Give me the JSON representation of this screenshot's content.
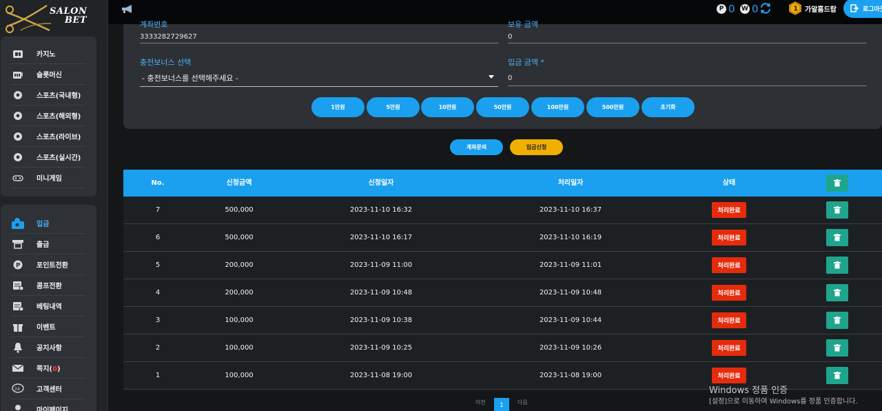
{
  "brand": {
    "line1": "SALON",
    "line2": "BET"
  },
  "sidebar": {
    "top_menu": [
      {
        "label": "카지노",
        "icon": "casino-icon"
      },
      {
        "label": "슬롯머신",
        "icon": "slot-icon"
      },
      {
        "label": "스포츠(국내형)",
        "icon": "soccer-ball-icon"
      },
      {
        "label": "스포츠(해외형)",
        "icon": "soccer-ball-icon"
      },
      {
        "label": "스포츠(라이브)",
        "icon": "soccer-ball-icon"
      },
      {
        "label": "스포츠(실시간)",
        "icon": "soccer-ball-icon"
      },
      {
        "label": "미니게임",
        "icon": "gamepad-icon"
      }
    ],
    "account_menu": [
      {
        "label": "입금",
        "icon": "deposit-icon",
        "active": true
      },
      {
        "label": "출금",
        "icon": "withdraw-icon"
      },
      {
        "label": "포인트전환",
        "icon": "point-icon"
      },
      {
        "label": "콤프전환",
        "icon": "comp-icon"
      },
      {
        "label": "베팅내역",
        "icon": "history-icon"
      },
      {
        "label": "이벤트",
        "icon": "gift-icon"
      },
      {
        "label": "공지사항",
        "icon": "bell-icon"
      },
      {
        "label": "쪽지",
        "icon": "mail-icon",
        "badge": "0"
      },
      {
        "label": "고객센터",
        "icon": "support-icon"
      },
      {
        "label": "마이페이지",
        "icon": "user-icon"
      }
    ]
  },
  "topbar": {
    "points_letter": "P",
    "points_value": "0",
    "wallet_letter": "W",
    "wallet_value": "0",
    "rank": "1",
    "username": "가알흠드랍",
    "logout_label": "로그아웃"
  },
  "form": {
    "account_label": "계좌번호",
    "account_value": "3333282729627",
    "balance_label": "보유 금액",
    "balance_value": "0",
    "bonus_label": "충전보너스 선택",
    "bonus_selected": "- 충전보너스를 선택해주세요 -",
    "amount_label": "입금 금액 *",
    "amount_value": "0",
    "amount_buttons": [
      "1만원",
      "5만원",
      "10만원",
      "50만원",
      "100만원",
      "500만원",
      "초기화"
    ]
  },
  "actions": {
    "inquiry": "계좌문의",
    "submit": "입금신청"
  },
  "table": {
    "headers": {
      "no": "No.",
      "amount": "신청금액",
      "request_date": "신청일자",
      "process_date": "처리일자",
      "status": "상태"
    },
    "rows": [
      {
        "no": "7",
        "amount": "500,000",
        "request_date": "2023-11-10 16:32",
        "process_date": "2023-11-10 16:37",
        "status": "처리완료"
      },
      {
        "no": "6",
        "amount": "500,000",
        "request_date": "2023-11-10 16:17",
        "process_date": "2023-11-10 16:19",
        "status": "처리완료"
      },
      {
        "no": "5",
        "amount": "200,000",
        "request_date": "2023-11-09 11:00",
        "process_date": "2023-11-09 11:01",
        "status": "처리완료"
      },
      {
        "no": "4",
        "amount": "200,000",
        "request_date": "2023-11-09 10:48",
        "process_date": "2023-11-09 10:48",
        "status": "처리완료"
      },
      {
        "no": "3",
        "amount": "100,000",
        "request_date": "2023-11-09 10:38",
        "process_date": "2023-11-09 10:44",
        "status": "처리완료"
      },
      {
        "no": "2",
        "amount": "100,000",
        "request_date": "2023-11-09 10:25",
        "process_date": "2023-11-09 10:26",
        "status": "처리완료"
      },
      {
        "no": "1",
        "amount": "100,000",
        "request_date": "2023-11-08 19:00",
        "process_date": "2023-11-08 19:00",
        "status": "처리완료"
      }
    ]
  },
  "pagination": {
    "prev": "이전",
    "current": "1",
    "next": "다음"
  },
  "watermark": {
    "line1": "Windows 정품 인증",
    "line2": "[설정]으로 이동하여 Windows를 정품 인증합니다."
  },
  "colors": {
    "accent": "#1aa0ef",
    "status": "#e52b0c",
    "delete": "#1fa58e",
    "submit": "#f0b000"
  }
}
